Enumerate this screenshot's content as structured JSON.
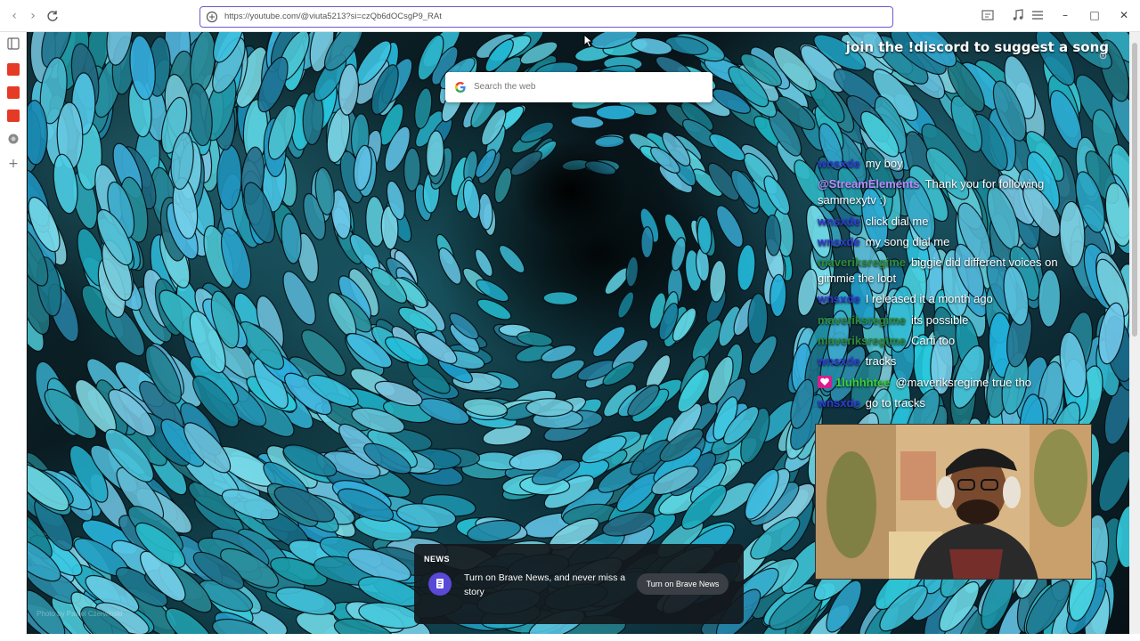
{
  "toolbar": {
    "url": "https://youtube.com/@viuta5213?si=czQb6dOCsgP9_RAt"
  },
  "search": {
    "placeholder": "Search the web"
  },
  "overlay": {
    "headline": "join the !discord to suggest a song"
  },
  "chat": {
    "messages": [
      {
        "user": "wnsxde",
        "user_color": "#2f3bd6",
        "text": "my boy"
      },
      {
        "user": "@StreamElements",
        "user_color": "#b98cff",
        "text": "Thank you for following sammexytv :)"
      },
      {
        "user": "wnsxde",
        "user_color": "#2f3bd6",
        "text": "click dial me"
      },
      {
        "user": "wnsxde",
        "user_color": "#2f3bd6",
        "text": "my song dial me"
      },
      {
        "user": "maveriksregime",
        "user_color": "#2e8b3c",
        "text": "biggie did different voices on gimmie the loot"
      },
      {
        "user": "wnsxde",
        "user_color": "#2f3bd6",
        "text": "I released it a month ago"
      },
      {
        "user": "maveriksregime",
        "user_color": "#2e8b3c",
        "text": "its possible"
      },
      {
        "user": "maveriksregime",
        "user_color": "#2e8b3c",
        "text": "Carti too"
      },
      {
        "user": "wnsxde",
        "user_color": "#2f3bd6",
        "text": "tracks"
      },
      {
        "user": "1luhhhtee",
        "user_color": "#39d13a",
        "text": "@maveriksregime true tho",
        "badge": "heart-badge"
      },
      {
        "user": "wnsxde",
        "user_color": "#2f3bd6",
        "text": "go to tracks"
      }
    ]
  },
  "news": {
    "tag": "NEWS",
    "text": "Turn on Brave News, and never miss a story",
    "button": "Turn on Brave News"
  },
  "credit": "Photo by Pawel Czerwinski",
  "colors": {
    "accent": "#5a48d8",
    "youtube_red": "#e53a25"
  }
}
